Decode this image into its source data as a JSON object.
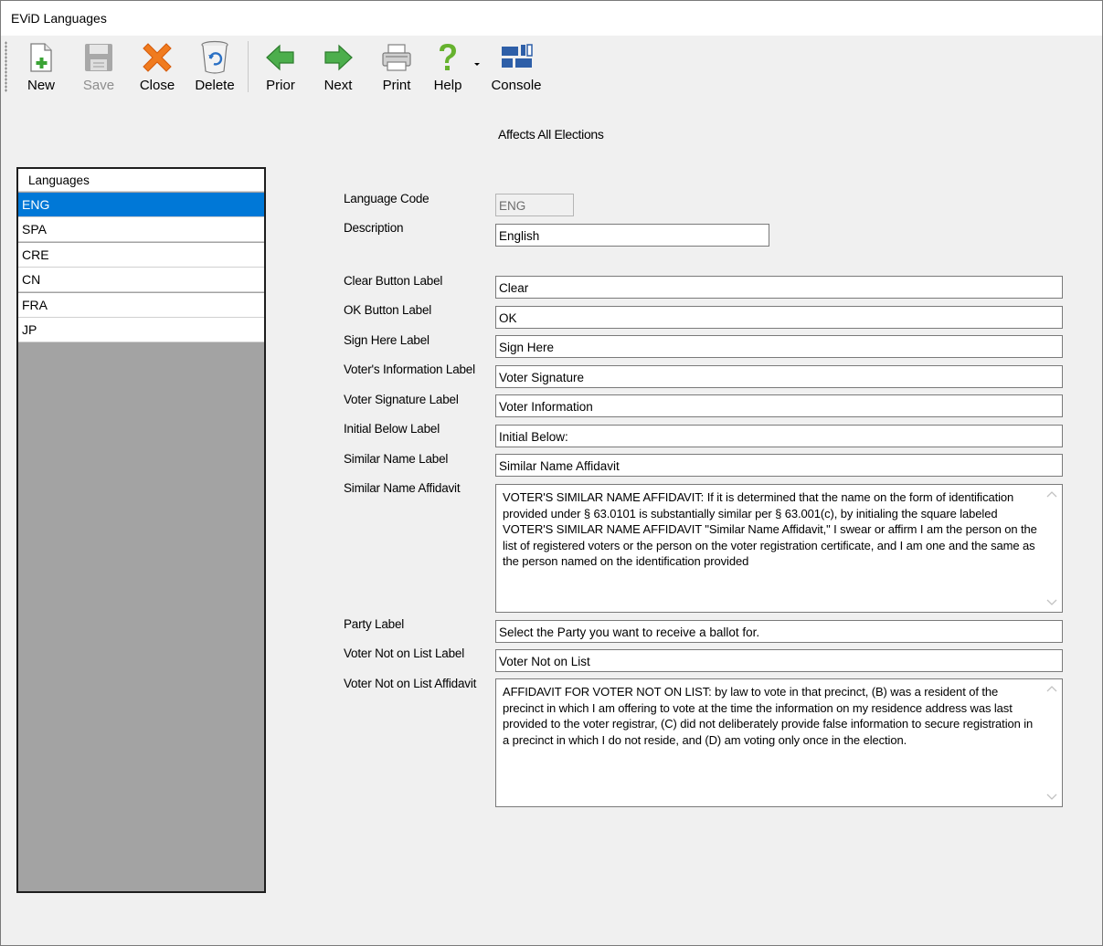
{
  "window": {
    "title": "EViD Languages"
  },
  "toolbar": {
    "new_label": "New",
    "save_label": "Save",
    "close_label": "Close",
    "delete_label": "Delete",
    "prior_label": "Prior",
    "next_label": "Next",
    "print_label": "Print",
    "help_label": "Help",
    "console_label": "Console"
  },
  "header": {
    "affects": "Affects All Elections"
  },
  "languages": {
    "header": "Languages",
    "items": [
      "ENG",
      "SPA",
      "CRE",
      "CN",
      "FRA",
      "JP"
    ],
    "selected": "ENG"
  },
  "form": {
    "language_code": {
      "label": "Language Code",
      "value": "ENG"
    },
    "description": {
      "label": "Description",
      "value": "English"
    },
    "clear_button": {
      "label": "Clear Button Label",
      "value": "Clear"
    },
    "ok_button": {
      "label": "OK Button Label",
      "value": "OK"
    },
    "sign_here": {
      "label": "Sign Here Label",
      "value": "Sign Here"
    },
    "voters_information": {
      "label": "Voter's Information Label",
      "value": "Voter Signature"
    },
    "voter_signature": {
      "label": "Voter Signature Label",
      "value": "Voter Information"
    },
    "initial_below": {
      "label": "Initial Below Label",
      "value": "Initial Below:"
    },
    "similar_name": {
      "label": "Similar Name Label",
      "value": "Similar Name Affidavit"
    },
    "similar_name_affidavit": {
      "label": "Similar Name Affidavit",
      "value": "VOTER'S SIMILAR NAME AFFIDAVIT: If it is determined that the name on the form of identification provided under § 63.0101 is substantially similar per § 63.001(c), by initialing the square labeled VOTER'S SIMILAR NAME AFFIDAVIT \"Similar Name Affidavit,\" I swear or affirm I am the person on the list of registered voters or the person on the voter registration certificate, and I am one and the same as the person named on the identification provided"
    },
    "party": {
      "label": "Party Label",
      "value": "Select the Party you want to receive a ballot for."
    },
    "voter_not_on_list": {
      "label": "Voter Not on List Label",
      "value": "Voter Not on List"
    },
    "voter_not_on_list_affidavit": {
      "label": "Voter Not on List Affidavit",
      "value": "AFFIDAVIT FOR VOTER NOT ON LIST: by law to vote in that precinct, (B) was a resident of the precinct in which I am offering to vote at the time the information on my residence address was last provided to the voter registrar, (C) did not deliberately provide false information to secure registration in a precinct in which I do not reside, and (D) am voting only once in the election."
    }
  },
  "icons": {
    "new": "new-document-icon",
    "save": "floppy-disk-icon",
    "close": "red-x-icon",
    "delete": "recycle-bin-icon",
    "prior": "green-left-arrow-icon",
    "next": "green-right-arrow-icon",
    "print": "printer-icon",
    "help": "question-mark-icon",
    "console": "console-tiles-icon"
  },
  "colors": {
    "selection": "#0078d7",
    "list_background": "#a3a3a3",
    "window_background": "#f0f0f0"
  }
}
